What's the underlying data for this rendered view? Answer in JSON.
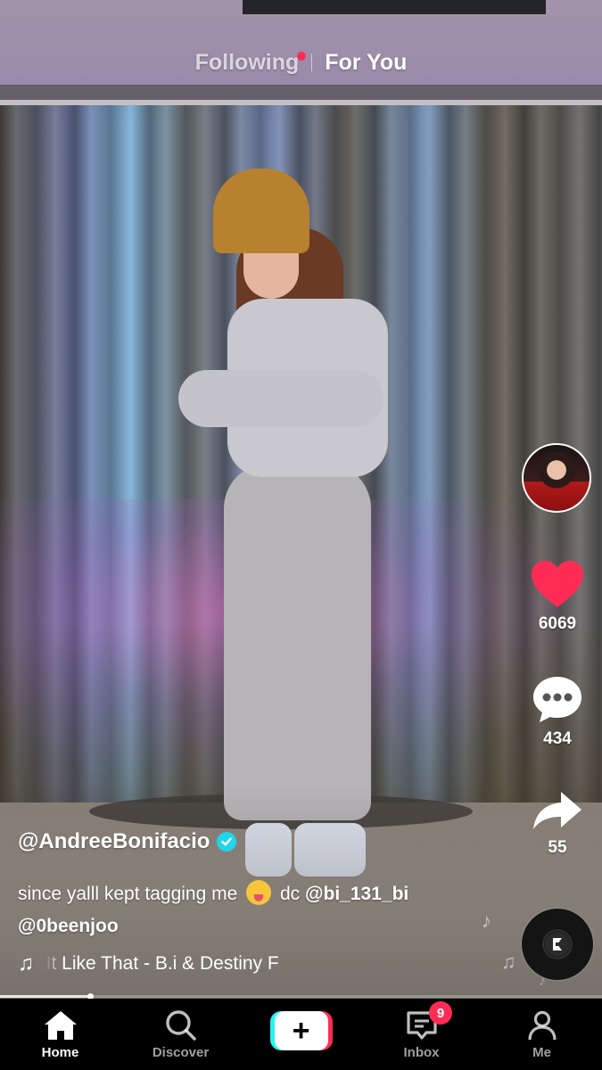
{
  "top_tabs": {
    "following": "Following",
    "for_you": "For You",
    "active": "For You"
  },
  "creator": {
    "username": "@AndreeBonifacio",
    "verified": true
  },
  "caption": {
    "text": "since yalll kept tagging me",
    "emoji": "squinting-face-with-tongue",
    "dc": "dc",
    "mention_1": "@bi_131_bi",
    "mention_2": "@0beenjoo"
  },
  "music": {
    "scrolling_text": "t It Like That - B.i & Destiny F"
  },
  "actions": {
    "likes": "6069",
    "comments": "434",
    "shares": "55"
  },
  "playback_progress": 0.15,
  "bottom_nav": {
    "home": "Home",
    "discover": "Discover",
    "inbox": "Inbox",
    "inbox_badge": "9",
    "me": "Me"
  },
  "colors": {
    "like_red": "#fe2c55",
    "create_cyan": "#25f4ee",
    "create_red": "#fe2c55",
    "verified_blue": "#20d5ec"
  }
}
